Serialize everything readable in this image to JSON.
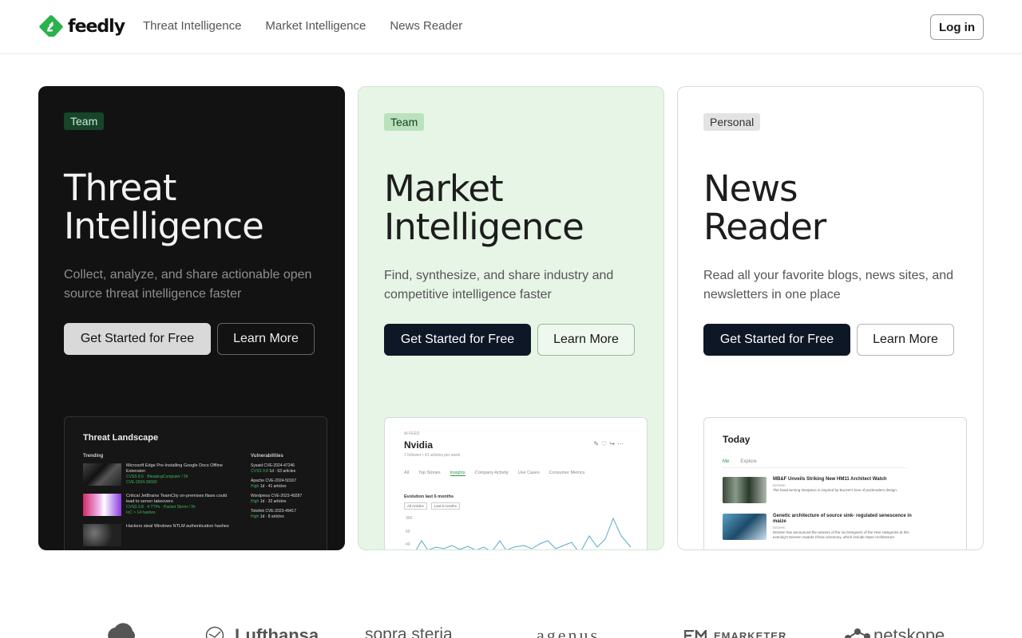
{
  "header": {
    "brand": "feedly",
    "nav": [
      "Threat Intelligence",
      "Market Intelligence",
      "News Reader"
    ],
    "login_label": "Log in"
  },
  "colors": {
    "brand_green": "#2bb24c",
    "dark_card": "#121212",
    "green_card": "#e6f5e6",
    "button_dark": "#0e1726"
  },
  "cards": [
    {
      "badge": "Team",
      "title_line1": "Threat",
      "title_line2": "Intelligence",
      "description": "Collect, analyze, and share actionable open source threat intelligence faster",
      "primary_label": "Get Started for Free",
      "secondary_label": "Learn More",
      "preview": {
        "title": "Threat Landscape",
        "trending_label": "Trending",
        "vuln_label": "Vulnerabilities",
        "trending": [
          {
            "headline": "Microsoft Edge Pre-Installing Google Docs Offline Extension",
            "meta": "CVSS 8.5 · BleepingComputer / 5h",
            "meta2": "CVE-2024-26600"
          },
          {
            "headline": "Critical JetBrains TeamCity on-premises flaws could lead to server takeovers",
            "meta": "CVSS 9.8 · 4 TTPs · Packet Storm / 3h",
            "meta2": "IoC > 14 hashes"
          },
          {
            "headline": "Hackers steal Windows NTLM authentication hashes",
            "meta": "",
            "meta2": ""
          }
        ],
        "vulns": [
          {
            "name": "Sysaid",
            "cve": "CVE-2024-47246",
            "score": "CVSS 9.8",
            "detail": "1d · 63 articles"
          },
          {
            "name": "Apache",
            "cve": "CVE-2024-50167",
            "score": "High",
            "detail": "1d · 41 articles"
          },
          {
            "name": "Wordpress",
            "cve": "CVE-2023-49287",
            "score": "High",
            "detail": "1d · 32 articles"
          },
          {
            "name": "Totolink",
            "cve": "CVE-2023-49417",
            "score": "High",
            "detail": "1d · 8 articles"
          }
        ]
      }
    },
    {
      "badge": "Team",
      "title_line1": "Market",
      "title_line2": "Intelligence",
      "description": "Find, synthesize, and share industry and competitive intelligence faster",
      "primary_label": "Get Started for Free",
      "secondary_label": "Learn More",
      "preview": {
        "small": "AI FEED",
        "title": "Nvidia",
        "sub": "1 follower • 41 articles per week",
        "tabs": [
          "All",
          "Top Stories",
          "Insights",
          "Company Activity",
          "Use Cases",
          "Consumer Metrics"
        ],
        "active_tab": "Insights",
        "evolution": "Evolution last 6 months",
        "filters": [
          "All Articles",
          "Last 6 months"
        ],
        "y_ticks": [
          "300",
          "60",
          "40"
        ]
      }
    },
    {
      "badge": "Personal",
      "title_line1": "News",
      "title_line2": "Reader",
      "description": "Read all your favorite blogs, news sites, and newsletters in one place",
      "primary_label": "Get Started for Free",
      "secondary_label": "Learn More",
      "preview": {
        "title": "Today",
        "tabs": [
          "Me",
          "Explore"
        ],
        "items": [
          {
            "headline": "MB&F Unveils Striking New HM11 Architect Watch",
            "source": "Dezeen",
            "body": "The head-turning timepiece is inspired by Buczer's love of postmodern design."
          },
          {
            "headline": "Genetic architecture of source sink- regulated senescence in maize",
            "source": "Dezeen",
            "body": "Dezeen has announced the winners of the six Designers of the Year categories at this evening's Dezeen Awards China ceremony, which include Open Architecture."
          }
        ]
      }
    }
  ],
  "customer_logos": [
    "Lufthansa",
    "sopra steria",
    "agenus",
    "EMARKETER",
    "netskope"
  ]
}
